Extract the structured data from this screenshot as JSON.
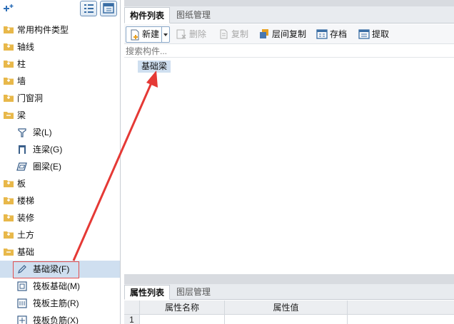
{
  "left_tree": {
    "items": [
      {
        "label": "常用构件类型",
        "level": 0,
        "icon": "folder-closed-icon"
      },
      {
        "label": "轴线",
        "level": 0,
        "icon": "folder-closed-icon"
      },
      {
        "label": "柱",
        "level": 0,
        "icon": "folder-closed-icon"
      },
      {
        "label": "墙",
        "level": 0,
        "icon": "folder-closed-icon"
      },
      {
        "label": "门窗洞",
        "level": 0,
        "icon": "folder-closed-icon"
      },
      {
        "label": "梁",
        "level": 0,
        "icon": "folder-open-icon"
      },
      {
        "label": "梁(L)",
        "level": 1,
        "icon": "beam-icon"
      },
      {
        "label": "连梁(G)",
        "level": 1,
        "icon": "coupling-beam-icon"
      },
      {
        "label": "圈梁(E)",
        "level": 1,
        "icon": "ring-beam-icon"
      },
      {
        "label": "板",
        "level": 0,
        "icon": "folder-closed-icon"
      },
      {
        "label": "楼梯",
        "level": 0,
        "icon": "folder-closed-icon"
      },
      {
        "label": "装修",
        "level": 0,
        "icon": "folder-closed-icon"
      },
      {
        "label": "土方",
        "level": 0,
        "icon": "folder-closed-icon"
      },
      {
        "label": "基础",
        "level": 0,
        "icon": "folder-open-icon"
      },
      {
        "label": "基础梁(F)",
        "level": 1,
        "icon": "pencil-icon",
        "selected": true
      },
      {
        "label": "筏板基础(M)",
        "level": 1,
        "icon": "raft-foundation-icon"
      },
      {
        "label": "筏板主筋(R)",
        "level": 1,
        "icon": "raft-main-rebar-icon"
      },
      {
        "label": "筏板负筋(X)",
        "level": 1,
        "icon": "raft-negative-rebar-icon"
      }
    ]
  },
  "component_panel": {
    "tabs": [
      {
        "label": "构件列表",
        "active": true
      },
      {
        "label": "图纸管理",
        "active": false
      }
    ],
    "toolbar": {
      "new": "新建",
      "delete": "删除",
      "copy": "复制",
      "floor_copy": "层间复制",
      "archive": "存档",
      "extract": "提取"
    },
    "search_placeholder": "搜索构件...",
    "items": [
      "基础梁"
    ]
  },
  "property_panel": {
    "tabs": [
      {
        "label": "属性列表",
        "active": true
      },
      {
        "label": "图层管理",
        "active": false
      }
    ],
    "columns": [
      "属性名称",
      "属性值"
    ],
    "first_row_number": "1"
  },
  "colors": {
    "selection": "#cfdff0",
    "annotation_red": "#e53935",
    "folder": "#e8b84a"
  }
}
